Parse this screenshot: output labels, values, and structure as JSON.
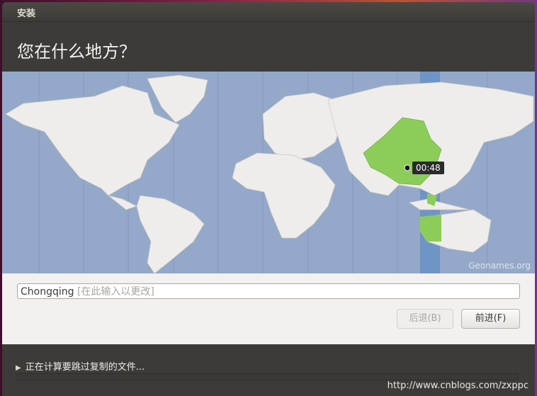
{
  "window": {
    "title": "安装"
  },
  "page": {
    "heading": "您在什么地方？"
  },
  "map": {
    "attribution": "Geonames.org",
    "time_tooltip": "00:48",
    "highlight_color": "#8ccd5a",
    "ocean_color": "#94a9c9",
    "selected_zone_color": "#6f94c6"
  },
  "location": {
    "value": "Chongqing",
    "hint": "[在此输入以更改]"
  },
  "buttons": {
    "back": "后退(B)",
    "forward": "前进(F)"
  },
  "status": {
    "text": "正在计算要跳过复制的文件..."
  },
  "watermark": "http://www.cnblogs.com/zxppc"
}
